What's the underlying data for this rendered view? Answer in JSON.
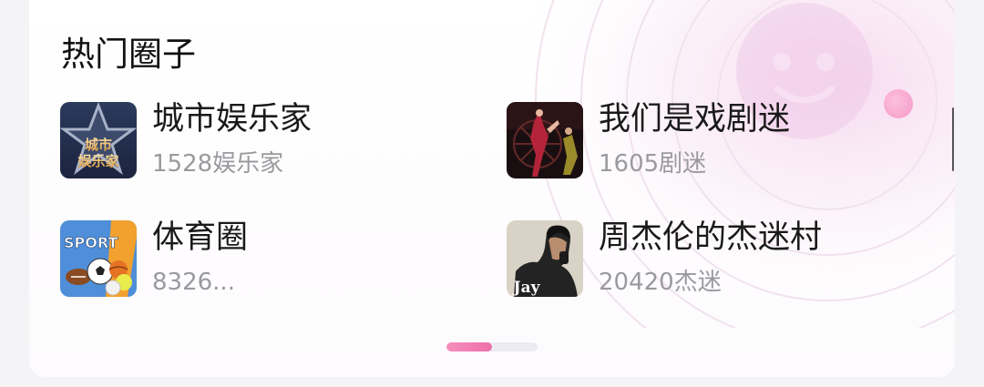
{
  "section_title": "热门圈子",
  "circles": [
    {
      "name": "城市娱乐家",
      "meta": "1528娱乐家",
      "thumb_text": [
        "城市",
        "娱乐家"
      ],
      "icon": "star-badge-icon"
    },
    {
      "name": "我们是戏剧迷",
      "meta": "1605剧迷",
      "icon": "stage-performance-photo"
    },
    {
      "name": "体育圈",
      "meta": "8326...",
      "thumb_text": [
        "SPORT"
      ],
      "icon": "sports-balls-icon"
    },
    {
      "name": "周杰伦的杰迷村",
      "meta": "20420杰迷",
      "thumb_text": [
        "Jay"
      ],
      "icon": "album-cover-photo"
    }
  ],
  "pager": {
    "page": 1,
    "pages": 2,
    "fill": 0.5
  },
  "colors": {
    "accent": "#ef74ab",
    "title": "#111111",
    "meta": "#9a9a9e"
  }
}
